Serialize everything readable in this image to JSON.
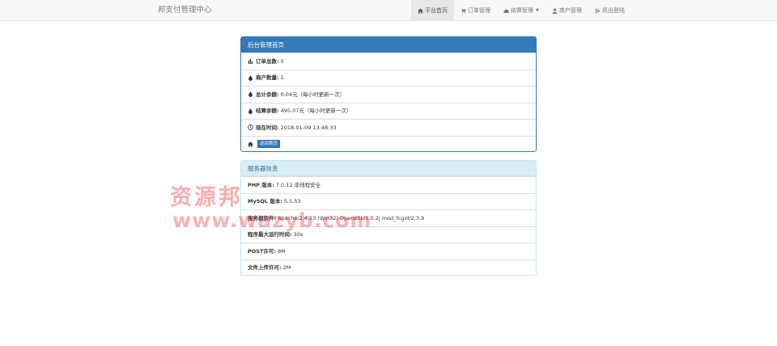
{
  "brand": "邦支付管理中心",
  "nav": [
    {
      "label": "平台首页",
      "icon": "home-icon",
      "active": true
    },
    {
      "label": "订单管理",
      "icon": "cart-icon"
    },
    {
      "label": "结算管理",
      "icon": "cloud-icon",
      "caret": true
    },
    {
      "label": "商户管理",
      "icon": "user-icon"
    },
    {
      "label": "退出登陆",
      "icon": "logout-icon"
    }
  ],
  "admin_panel": {
    "title": "后台管理首页",
    "items": [
      {
        "icon": "bar-chart-icon",
        "label": "订单总数:",
        "value": "0"
      },
      {
        "icon": "tint-icon",
        "label": "商户数量:",
        "value": "1"
      },
      {
        "icon": "tint-icon",
        "label": "总计余额:",
        "value": "0.04元（每小时更新一次）"
      },
      {
        "icon": "tint-icon",
        "label": "结算余额:",
        "value": "495.07元（每小时更新一次）"
      },
      {
        "icon": "clock-icon",
        "label": "现在时间:",
        "value": "2018-01-09 13:48:33"
      }
    ],
    "back_button": "返回首页"
  },
  "server_panel": {
    "title": "服务器信息",
    "items": [
      {
        "label": "PHP 版本:",
        "value": "7.0.12 非线程安全"
      },
      {
        "label": "MySQL 版本:",
        "value": "5.5.53"
      },
      {
        "label": "服务器软件:",
        "value": "Apache/2.4.23 (Win32) OpenSSL/1.0.2j mod_fcgid/2.3.9"
      },
      {
        "label": "程序最大运行时间:",
        "value": "30s"
      },
      {
        "label": "POST许可:",
        "value": "8M"
      },
      {
        "label": "文件上传许可:",
        "value": "2M"
      }
    ]
  },
  "watermark": {
    "cn": "资源邦",
    "en": "www.wazyb.com"
  }
}
